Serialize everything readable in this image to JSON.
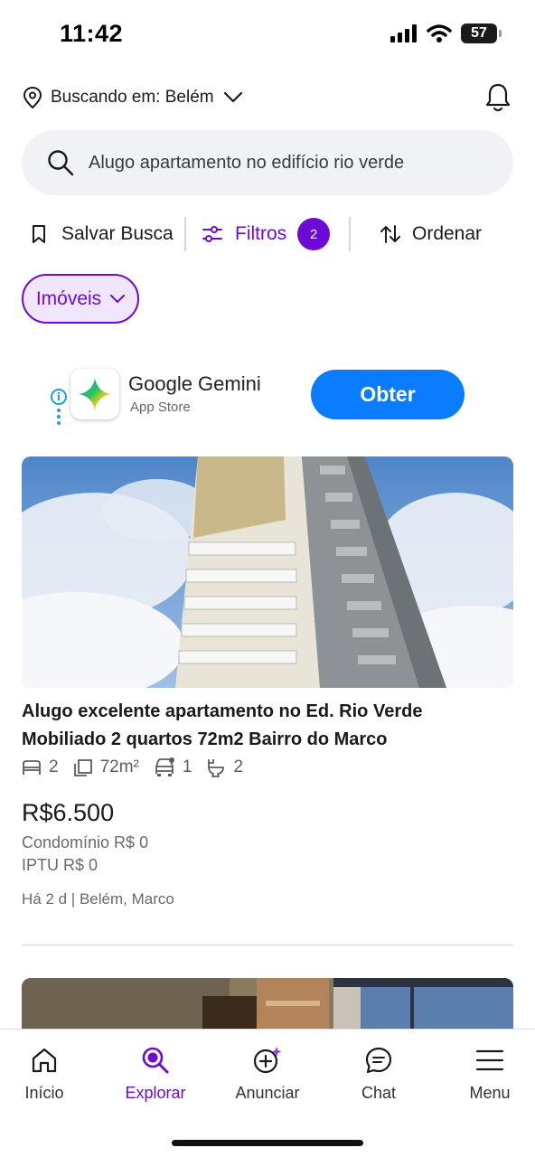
{
  "status_bar": {
    "time": "11:42",
    "battery": "57"
  },
  "location": {
    "label": "Buscando em: Belém"
  },
  "search": {
    "query": "Alugo apartamento no edifício rio verde"
  },
  "actions": {
    "save_search": "Salvar Busca",
    "filters": "Filtros",
    "filters_count": "2",
    "sort": "Ordenar"
  },
  "category_chip": {
    "label": "Imóveis"
  },
  "ad": {
    "title": "Google Gemini",
    "subtitle": "App Store",
    "cta": "Obter"
  },
  "listing": {
    "title_line1": "Alugo excelente apartamento no Ed. Rio Verde",
    "title_line2": "Mobiliado 2 quartos 72m2 Bairro do Marco",
    "bedrooms": "2",
    "area": "72m²",
    "parking": "1",
    "bathrooms": "2",
    "price": "R$6.500",
    "condo_fee": "Condomínio R$ 0",
    "iptu": "IPTU R$ 0",
    "meta": "Há 2 d | Belém, Marco"
  },
  "tabbar": {
    "items": [
      {
        "label": "Início"
      },
      {
        "label": "Explorar"
      },
      {
        "label": "Anunciar"
      },
      {
        "label": "Chat"
      },
      {
        "label": "Menu"
      }
    ]
  },
  "colors": {
    "accent": "#6e0ad6",
    "cta_blue": "#0a7cff",
    "search_bg": "#f0f2f5"
  }
}
